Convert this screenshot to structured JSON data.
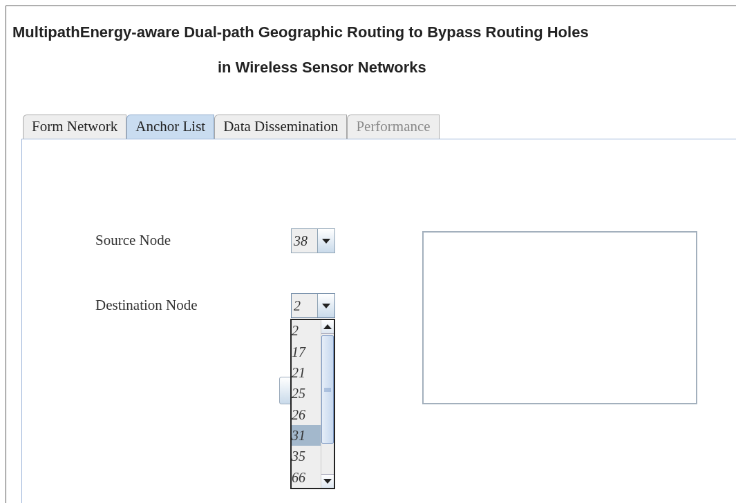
{
  "title": {
    "line_1": "MultipathEnergy-aware Dual-path Geographic Routing to Bypass Routing Holes",
    "line_2": "in Wireless Sensor Networks"
  },
  "tabs": [
    {
      "label": "Form Network",
      "selected": false,
      "disabled": false
    },
    {
      "label": "Anchor List",
      "selected": true,
      "disabled": false
    },
    {
      "label": "Data Dissemination",
      "selected": false,
      "disabled": false
    },
    {
      "label": "Performance",
      "selected": false,
      "disabled": true
    }
  ],
  "source_node": {
    "label": "Source Node",
    "value": "38",
    "expanded": false
  },
  "destination_node": {
    "label": "Destination Node",
    "value": "2",
    "expanded": true,
    "options": [
      {
        "label": "2",
        "highlighted": false
      },
      {
        "label": "17",
        "highlighted": false
      },
      {
        "label": "21",
        "highlighted": false
      },
      {
        "label": "25",
        "highlighted": false
      },
      {
        "label": "26",
        "highlighted": false
      },
      {
        "label": "31",
        "highlighted": true
      },
      {
        "label": "35",
        "highlighted": false
      },
      {
        "label": "66",
        "highlighted": false
      }
    ]
  }
}
